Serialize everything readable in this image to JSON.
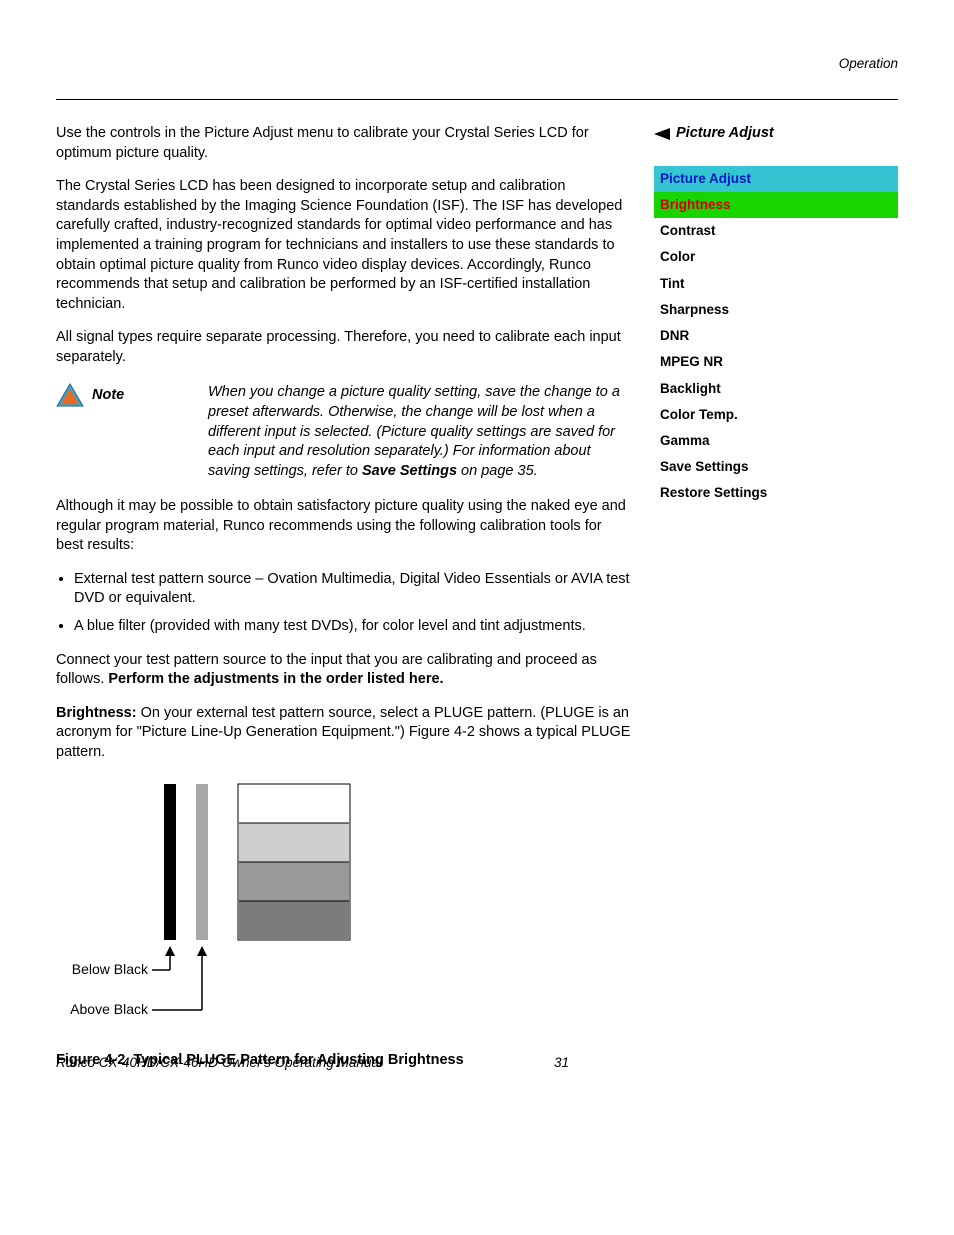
{
  "header": {
    "section": "Operation"
  },
  "body": {
    "p1": "Use the controls in the Picture Adjust menu to calibrate your Crystal Series LCD for optimum picture quality.",
    "p2": "The Crystal Series LCD has been designed to incorporate setup and calibration standards established by the Imaging Science Foundation (ISF). The ISF has developed carefully crafted, industry-recognized standards for optimal video performance and has implemented a training program for technicians and installers to use these standards to obtain optimal picture quality from Runco video display devices. Accordingly, Runco recommends that setup and calibration be performed by an ISF-certified installation technician.",
    "p3": "All signal types require separate processing. Therefore, you need to calibrate each input separately.",
    "note_label": "Note",
    "note_text_a": "When you change a picture quality setting, save the change to a preset afterwards. Otherwise, the change will be lost when a different input is selected. (Picture quality settings are saved for each input and resolution separately.) For information about saving settings, refer to ",
    "note_text_bold": "Save Settings",
    "note_text_b": " on page 35.",
    "p4": "Although it may be possible to obtain satisfactory picture quality using the naked eye and regular program material, Runco recommends using the following calibration tools for best results:",
    "bullets": [
      "External test pattern source – Ovation Multimedia, Digital Video Essentials or AVIA test DVD or equivalent.",
      "A blue filter (provided with many test DVDs), for color level and tint adjustments."
    ],
    "p5a": "Connect your test pattern source to the input that you are calibrating and proceed as follows. ",
    "p5b": "Perform the adjustments in the order listed here.",
    "p6_lead": "Brightness: ",
    "p6": "On your external test pattern source, select a PLUGE pattern. (PLUGE is an acronym for \"Picture Line-Up Generation Equipment.\") Figure 4-2 shows a typical PLUGE pattern.",
    "fig_below": "Below Black",
    "fig_above": "Above Black",
    "fig_caption": "Figure 4-2. Typical PLUGE Pattern for Adjusting Brightness"
  },
  "sidebar": {
    "title": "Picture Adjust",
    "menu_header": "Picture Adjust",
    "menu_highlight": "Brightness",
    "menu_items": [
      "Contrast",
      "Color",
      "Tint",
      "Sharpness",
      "DNR",
      "MPEG NR",
      "Backlight",
      "Color Temp.",
      "Gamma",
      "Save Settings",
      "Restore Settings"
    ]
  },
  "footer": {
    "title": "Runco CX-40HD/CX-46HD Owner's Operating Manual",
    "page": "31"
  }
}
